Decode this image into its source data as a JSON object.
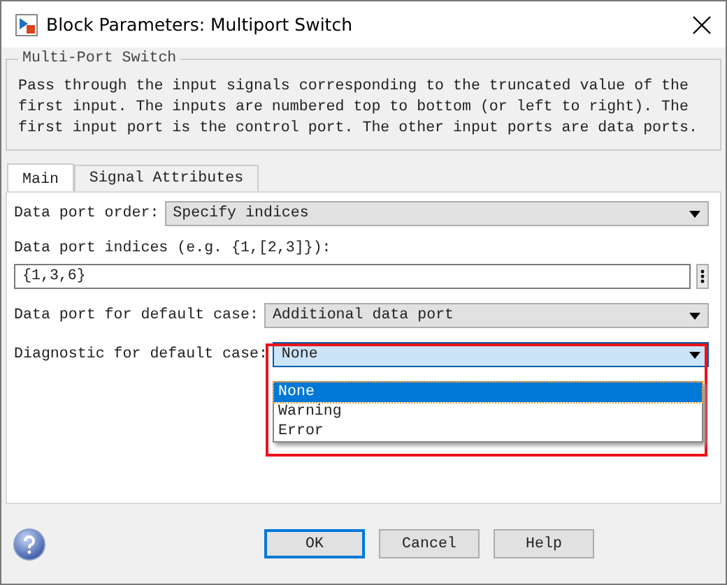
{
  "window": {
    "title": "Block Parameters: Multiport Switch"
  },
  "group": {
    "title": "Multi-Port Switch",
    "description": "Pass through the input signals corresponding to the truncated value of the first input. The inputs are numbered top to bottom (or left to right). The first input port is the control port. The other input ports are data ports."
  },
  "tabs": [
    {
      "label": "Main",
      "selected": true
    },
    {
      "label": "Signal Attributes",
      "selected": false
    }
  ],
  "fields": [
    {
      "kind": "dropdown",
      "label": "Data port order:",
      "value": "Specify indices",
      "focused": false
    },
    {
      "kind": "text",
      "label": "Data port indices (e.g. {1,[2,3]}):",
      "value": "{1,3,6}"
    },
    {
      "kind": "dropdown",
      "label": "Data port for default case:",
      "value": "Additional data port",
      "focused": false
    },
    {
      "kind": "dropdown",
      "label": "Diagnostic for default case:",
      "value": "None",
      "focused": true,
      "highlighted": true,
      "options": [
        {
          "label": "None",
          "selected": true
        },
        {
          "label": "Warning",
          "selected": false
        },
        {
          "label": "Error",
          "selected": false
        }
      ]
    }
  ],
  "buttons": [
    {
      "label": "OK",
      "default": true
    },
    {
      "label": "Cancel",
      "default": false
    },
    {
      "label": "Help",
      "default": false
    }
  ]
}
